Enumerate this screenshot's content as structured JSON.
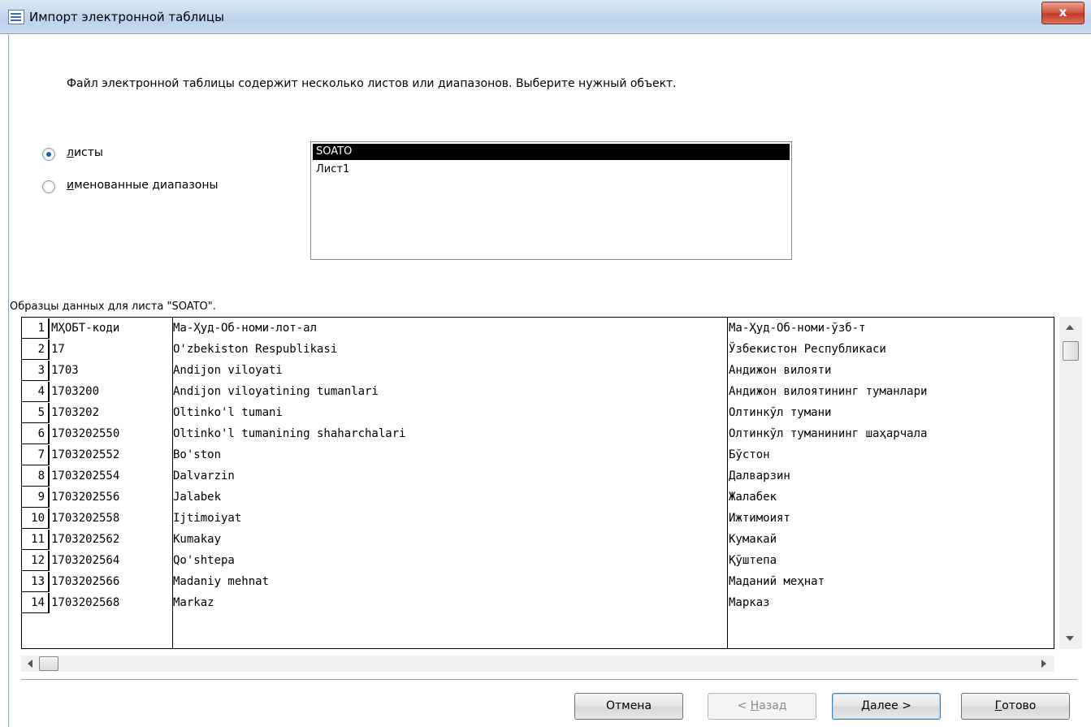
{
  "window": {
    "title": "Импорт электронной таблицы",
    "close_label": "x"
  },
  "instruction": "Файл электронной таблицы содержит несколько листов или диапазонов.  Выберите нужный объект.",
  "options": {
    "sheets_label_key": "л",
    "sheets_label_rest": "исты",
    "ranges_label_key": "и",
    "ranges_label_rest": "менованные диапазоны",
    "selected": "sheets"
  },
  "objects": [
    "SOATO",
    "Лист1"
  ],
  "selected_object": "SOATO",
  "sample_label": "Образцы данных для листа \"SOATO\".",
  "sample_rows": [
    {
      "n": "1",
      "code": "МҲОБТ-коди",
      "lat": "Ма-Ҳуд-Об-номи-лот-ал",
      "uzb": "Ма-Ҳуд-Об-номи-ўзб-т"
    },
    {
      "n": "2",
      "code": "17",
      "lat": "O'zbekiston Respublikasi",
      "uzb": "Ўзбекистон Республикаси"
    },
    {
      "n": "3",
      "code": "1703",
      "lat": "Andijon viloyati",
      "uzb": "Андижон вилояти"
    },
    {
      "n": "4",
      "code": "1703200",
      "lat": "Andijon viloyatining tumanlari",
      "uzb": "Андижон вилоятининг туманлари"
    },
    {
      "n": "5",
      "code": "1703202",
      "lat": "Oltinko'l tumani",
      "uzb": "Олтинкўл тумани"
    },
    {
      "n": "6",
      "code": "1703202550",
      "lat": "Oltinko'l tumanining shaharchalari",
      "uzb": "Олтинкўл туманининг шаҳарчала"
    },
    {
      "n": "7",
      "code": "1703202552",
      "lat": "Bo'ston",
      "uzb": "Бўстон"
    },
    {
      "n": "8",
      "code": "1703202554",
      "lat": "Dalvarzin",
      "uzb": "Далварзин"
    },
    {
      "n": "9",
      "code": "1703202556",
      "lat": "Jalabek",
      "uzb": "Жалабек"
    },
    {
      "n": "10",
      "code": "1703202558",
      "lat": "Ijtimoiyat",
      "uzb": "Ижтимоият"
    },
    {
      "n": "11",
      "code": "1703202562",
      "lat": "Kumakay",
      "uzb": "Кумакай"
    },
    {
      "n": "12",
      "code": "1703202564",
      "lat": "Qo'shtepa",
      "uzb": "Қўштепа"
    },
    {
      "n": "13",
      "code": "1703202566",
      "lat": "Madaniy mehnat",
      "uzb": "Маданий меҳнат"
    },
    {
      "n": "14",
      "code": "1703202568",
      "lat": "Markaz",
      "uzb": "Марказ"
    }
  ],
  "buttons": {
    "cancel": "Отмена",
    "back_prefix": "< ",
    "back_key": "Н",
    "back_rest": "азад",
    "next_key": "Д",
    "next_rest": "алее >",
    "finish_key": "Г",
    "finish_rest": "отово"
  },
  "colors": {
    "selection": "#000000",
    "titlebar": "#c7daee",
    "close": "#c43c26"
  }
}
